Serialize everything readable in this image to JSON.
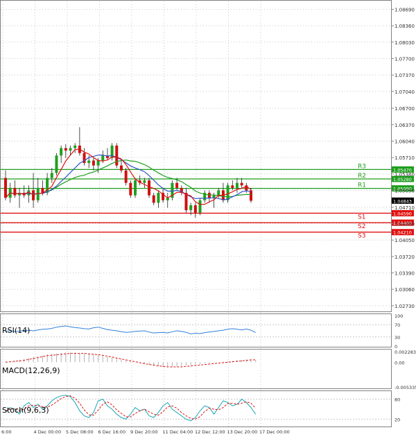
{
  "chart_data": [
    {
      "type": "candlestick",
      "panel": "price",
      "y_ticks": [
        "1.08690",
        "1.08360",
        "1.08030",
        "1.07700",
        "1.07370",
        "1.07040",
        "1.06700",
        "1.06370",
        "1.06040",
        "1.05710",
        "1.05380",
        "1.05050",
        "1.04710",
        "1.04380",
        "1.04050",
        "1.03720",
        "1.03390",
        "1.03060",
        "1.02730"
      ],
      "ylim": [
        1.0263,
        1.0885
      ],
      "x_ticks": [
        "6:00",
        "4 Dec 00:00",
        "5 Dec 08:00",
        "6 Dec 16:00",
        "9 Dec 20:00",
        "11 Dec 04:00",
        "12 Dec 12:00",
        "13 Dec 20:00",
        "17 Dec 00:00"
      ],
      "current_price": {
        "label": "1.04843",
        "value": 1.04843
      },
      "levels": [
        {
          "name": "R3",
          "label": "1.05470",
          "value": 1.0547,
          "color": "#1e9e1e"
        },
        {
          "name": "R2",
          "label": "1.05280",
          "value": 1.0528,
          "color": "#1e9e1e"
        },
        {
          "name": "R1",
          "label": "1.05090",
          "value": 1.0509,
          "color": "#1e9e1e"
        },
        {
          "name": "S1",
          "label": "1.04590",
          "value": 1.0459,
          "color": "#e01010"
        },
        {
          "name": "S2",
          "label": "1.04400",
          "value": 1.044,
          "color": "#e01010"
        },
        {
          "name": "S3",
          "label": "1.04210",
          "value": 1.0421,
          "color": "#e01010"
        }
      ],
      "candles": [
        [
          1.053,
          1.0545,
          1.0485,
          1.049
        ],
        [
          1.049,
          1.052,
          1.048,
          1.051
        ],
        [
          1.051,
          1.0525,
          1.049,
          1.0495
        ],
        [
          1.0495,
          1.051,
          1.047,
          1.05
        ],
        [
          1.05,
          1.0515,
          1.049,
          1.0495
        ],
        [
          1.0495,
          1.0515,
          1.048,
          1.0505
        ],
        [
          1.0505,
          1.054,
          1.047,
          1.0485
        ],
        [
          1.0485,
          1.053,
          1.048,
          1.051
        ],
        [
          1.051,
          1.0525,
          1.0495,
          1.05
        ],
        [
          1.05,
          1.054,
          1.0495,
          1.053
        ],
        [
          1.053,
          1.055,
          1.052,
          1.054
        ],
        [
          1.054,
          1.058,
          1.0535,
          1.0575
        ],
        [
          1.0575,
          1.0595,
          1.056,
          1.059
        ],
        [
          1.059,
          1.0598,
          1.057,
          1.0585
        ],
        [
          1.0585,
          1.0595,
          1.0575,
          1.059
        ],
        [
          1.059,
          1.06,
          1.058,
          1.0595
        ],
        [
          1.0595,
          1.0632,
          1.0575,
          1.058
        ],
        [
          1.058,
          1.059,
          1.0555,
          1.056
        ],
        [
          1.056,
          1.0575,
          1.055,
          1.0565
        ],
        [
          1.0565,
          1.057,
          1.0545,
          1.0555
        ],
        [
          1.0555,
          1.057,
          1.054,
          1.0565
        ],
        [
          1.0565,
          1.0585,
          1.056,
          1.0575
        ],
        [
          1.0575,
          1.059,
          1.0565,
          1.057
        ],
        [
          1.057,
          1.06,
          1.0565,
          1.0595
        ],
        [
          1.0595,
          1.06,
          1.055,
          1.0555
        ],
        [
          1.0555,
          1.0565,
          1.054,
          1.0545
        ],
        [
          1.0545,
          1.055,
          1.0515,
          1.052
        ],
        [
          1.052,
          1.0525,
          1.049,
          1.0495
        ],
        [
          1.0495,
          1.053,
          1.049,
          1.0525
        ],
        [
          1.0525,
          1.0535,
          1.0515,
          1.052
        ],
        [
          1.052,
          1.053,
          1.051,
          1.0525
        ],
        [
          1.0525,
          1.053,
          1.049,
          1.0495
        ],
        [
          1.0495,
          1.05,
          1.0475,
          1.048
        ],
        [
          1.048,
          1.0505,
          1.047,
          1.05
        ],
        [
          1.05,
          1.051,
          1.048,
          1.0485
        ],
        [
          1.0485,
          1.05,
          1.047,
          1.049
        ],
        [
          1.049,
          1.0525,
          1.0485,
          1.052
        ],
        [
          1.052,
          1.053,
          1.0505,
          1.051
        ],
        [
          1.051,
          1.0515,
          1.0495,
          1.05
        ],
        [
          1.05,
          1.051,
          1.046,
          1.0465
        ],
        [
          1.0465,
          1.048,
          1.0455,
          1.0475
        ],
        [
          1.0475,
          1.048,
          1.045,
          1.046
        ],
        [
          1.046,
          1.049,
          1.0455,
          1.0485
        ],
        [
          1.0485,
          1.0505,
          1.048,
          1.05
        ],
        [
          1.05,
          1.0505,
          1.048,
          1.049
        ],
        [
          1.049,
          1.05,
          1.047,
          1.0495
        ],
        [
          1.0495,
          1.051,
          1.049,
          1.0505
        ],
        [
          1.0505,
          1.052,
          1.048,
          1.0485
        ],
        [
          1.0485,
          1.052,
          1.048,
          1.0515
        ],
        [
          1.0515,
          1.0525,
          1.0505,
          1.051
        ],
        [
          1.051,
          1.053,
          1.05,
          1.052
        ],
        [
          1.052,
          1.053,
          1.051,
          1.0515
        ],
        [
          1.0515,
          1.052,
          1.05,
          1.0505
        ],
        [
          1.0505,
          1.051,
          1.048,
          1.0484
        ]
      ],
      "overlays": [
        {
          "name": "MA fast",
          "color": "#e01010"
        },
        {
          "name": "MA mid",
          "color": "#2f55c8"
        },
        {
          "name": "MA slow",
          "color": "#1e9e1e"
        }
      ]
    },
    {
      "type": "line",
      "panel": "oscillator",
      "label": "RSI(14)",
      "y_ticks": [
        "100",
        "70",
        "30",
        "0"
      ],
      "ylim": [
        0,
        100
      ],
      "series": [
        {
          "color": "#2f7fd8",
          "values": [
            48,
            50,
            47,
            49,
            51,
            52,
            50,
            53,
            55,
            56,
            58,
            62,
            64,
            66,
            63,
            61,
            59,
            57,
            56,
            60,
            62,
            58,
            54,
            52,
            50,
            47,
            45,
            46,
            48,
            49,
            50,
            46,
            43,
            44,
            45,
            43,
            47,
            50,
            48,
            45,
            40,
            42,
            41,
            44,
            46,
            48,
            50,
            52,
            55,
            57,
            55,
            53,
            56,
            52,
            44
          ]
        }
      ]
    },
    {
      "type": "bar",
      "panel": "oscillator",
      "label": "MACD(12,26,9)",
      "y_ticks": [
        "0.002283",
        "0.00",
        "-0.005335"
      ],
      "ylim": [
        -0.005335,
        0.002283
      ],
      "histogram": [
        0.0001,
        0.0002,
        0.0003,
        0.0005,
        0.0007,
        0.0009,
        0.0011,
        0.0013,
        0.0015,
        0.0017,
        0.0018,
        0.0019,
        0.002,
        0.0021,
        0.0021,
        0.0021,
        0.002,
        0.0019,
        0.0018,
        0.0017,
        0.0016,
        0.0014,
        0.0012,
        0.001,
        0.0008,
        0.0006,
        0.0004,
        0.0002,
        0.0,
        -0.0002,
        -0.0004,
        -0.0006,
        -0.0008,
        -0.0009,
        -0.001,
        -0.001,
        -0.001,
        -0.0009,
        -0.0008,
        -0.0007,
        -0.0006,
        -0.0005,
        -0.0004,
        -0.0003,
        -0.0002,
        -0.0001,
        0.0,
        0.0001,
        0.0002,
        0.0003,
        0.0004,
        0.0005,
        0.0006,
        0.0006,
        0.0005
      ],
      "signal": [
        0.0,
        0.0001,
        0.0002,
        0.0003,
        0.0004,
        0.0006,
        0.0008,
        0.001,
        0.0012,
        0.0014,
        0.0015,
        0.0016,
        0.0017,
        0.0018,
        0.0019,
        0.0019,
        0.0019,
        0.0019,
        0.0018,
        0.0017,
        0.0016,
        0.0015,
        0.0013,
        0.0011,
        0.0009,
        0.0007,
        0.0005,
        0.0003,
        0.0001,
        -0.0001,
        -0.0003,
        -0.0005,
        -0.0006,
        -0.0008,
        -0.0009,
        -0.001,
        -0.001,
        -0.001,
        -0.001,
        -0.0009,
        -0.0008,
        -0.0007,
        -0.0006,
        -0.0005,
        -0.0004,
        -0.0003,
        -0.0002,
        -0.0001,
        0.0,
        0.0001,
        0.0002,
        0.0003,
        0.0004,
        0.0005,
        0.0005
      ],
      "signal_color": "#e01010",
      "histogram_color": "#b0b0b0"
    },
    {
      "type": "line",
      "panel": "oscillator",
      "label": "Stoch(9,6,3)",
      "y_ticks": [
        "80",
        "20"
      ],
      "ylim": [
        0,
        100
      ],
      "series": [
        {
          "color": "#1aa7b5",
          "values": [
            40,
            55,
            50,
            35,
            60,
            70,
            55,
            65,
            50,
            60,
            75,
            85,
            90,
            92,
            88,
            70,
            45,
            30,
            25,
            40,
            75,
            80,
            60,
            50,
            35,
            25,
            20,
            35,
            55,
            45,
            50,
            30,
            25,
            40,
            60,
            70,
            50,
            40,
            30,
            20,
            15,
            25,
            45,
            60,
            55,
            35,
            55,
            75,
            70,
            60,
            65,
            80,
            70,
            55,
            35
          ]
        },
        {
          "color": "#e01010",
          "values": [
            45,
            50,
            52,
            45,
            50,
            60,
            62,
            60,
            58,
            56,
            62,
            72,
            82,
            88,
            90,
            83,
            68,
            48,
            33,
            32,
            47,
            65,
            72,
            63,
            48,
            37,
            27,
            27,
            37,
            45,
            50,
            42,
            35,
            32,
            42,
            57,
            60,
            53,
            40,
            30,
            22,
            20,
            28,
            43,
            53,
            50,
            48,
            55,
            67,
            68,
            65,
            68,
            72,
            68,
            53
          ]
        }
      ],
      "x_ticks": [
        "6:00",
        "4 Dec 00:00",
        "5 Dec 08:00",
        "6 Dec 16:00",
        "9 Dec 20:00",
        "11 Dec 04:00",
        "12 Dec 12:00",
        "13 Dec 20:00",
        "17 Dec 00:00"
      ]
    }
  ]
}
